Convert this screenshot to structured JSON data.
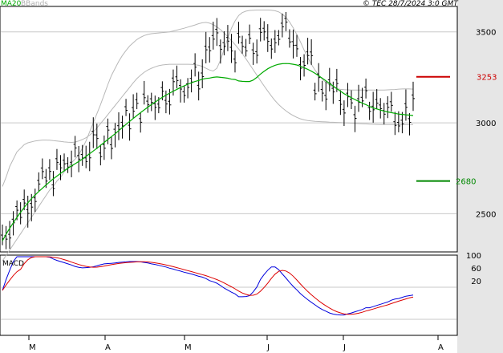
{
  "header": {
    "ma_label": "MA20",
    "bb_label": "BBands",
    "copyright": "© TEC 28/7/2024 3:0 GMT"
  },
  "colors": {
    "ma": "#00aa00",
    "bbands": "#b8b8b8",
    "resistance": "#cc0000",
    "support": "#008800",
    "macd": "#0000dd",
    "signal": "#dd0000",
    "candles": "#000000",
    "grid": "#c8c8c8",
    "panel_bg": "#ffffff",
    "side_bg": "#e8e8e8"
  },
  "chart_data": [
    {
      "type": "line",
      "subtype": "ohlc-bars",
      "title": "",
      "ylim": [
        2290,
        3640
      ],
      "y_ticks": [
        3500,
        3000,
        2500
      ],
      "x_ticks": [
        "M",
        "A",
        "M",
        "J",
        "J",
        "A"
      ],
      "levels": [
        {
          "label": "3253",
          "value": 3253,
          "role": "resistance"
        },
        {
          "label": "2680",
          "value": 2680,
          "role": "support"
        }
      ],
      "series": [
        {
          "name": "MA20",
          "values": [
            2350,
            2387,
            2420,
            2450,
            2480,
            2508,
            2535,
            2560,
            2583,
            2603,
            2622,
            2640,
            2658,
            2675,
            2692,
            2707,
            2722,
            2736,
            2750,
            2763,
            2775,
            2787,
            2800,
            2815,
            2830,
            2845,
            2860,
            2876,
            2892,
            2908,
            2924,
            2940,
            2957,
            2974,
            2991,
            3008,
            3024,
            3040,
            3056,
            3071,
            3086,
            3100,
            3114,
            3127,
            3140,
            3152,
            3163,
            3174,
            3184,
            3194,
            3203,
            3212,
            3220,
            3227,
            3233,
            3240,
            3244,
            3246,
            3250,
            3252,
            3250,
            3248,
            3245,
            3240,
            3238,
            3230,
            3228,
            3227,
            3227,
            3235,
            3250,
            3268,
            3283,
            3297,
            3308,
            3316,
            3322,
            3325,
            3326,
            3325,
            3322,
            3318,
            3311,
            3303,
            3294,
            3284,
            3272,
            3259,
            3245,
            3231,
            3216,
            3202,
            3188,
            3174,
            3160,
            3150,
            3138,
            3128,
            3118,
            3108,
            3100,
            3090,
            3082,
            3076,
            3070,
            3064,
            3060,
            3056,
            3052,
            3048,
            3046,
            3044,
            3042,
            3040
          ]
        },
        {
          "name": "BB-upper",
          "values": [
            2650,
            2700,
            2760,
            2800,
            2840,
            2860,
            2880,
            2890,
            2895,
            2900,
            2903,
            2905,
            2905,
            2904,
            2902,
            2900,
            2898,
            2895,
            2893,
            2892,
            2894,
            2900,
            2908,
            2918,
            2932,
            2950,
            2972,
            2996,
            3020,
            3045,
            3070,
            3095,
            3120,
            3145,
            3170,
            3195,
            3220,
            3243,
            3262,
            3278,
            3290,
            3300,
            3308,
            3314,
            3318,
            3320,
            3322,
            3322,
            3322,
            3322,
            3322,
            3322,
            3321,
            3319,
            3316,
            3310,
            3300,
            3290,
            3285,
            3300,
            3345,
            3405,
            3465,
            3520,
            3560,
            3590,
            3606,
            3614,
            3618,
            3619,
            3620,
            3620,
            3620,
            3620,
            3619,
            3616,
            3610,
            3598,
            3580,
            3555,
            3522,
            3485,
            3445,
            3400,
            3360,
            3322,
            3290,
            3262,
            3240,
            3222,
            3208,
            3196,
            3188,
            3184,
            3182,
            3181,
            3180,
            3180,
            3180,
            3180,
            3180,
            3180,
            3180,
            3180,
            3180,
            3180,
            3181,
            3182,
            3183,
            3185,
            3186,
            3187,
            3186,
            3185
          ]
        },
        {
          "name": "BB-lower",
          "values": [
            2240,
            2270,
            2300,
            2330,
            2360,
            2390,
            2420,
            2450,
            2480,
            2510,
            2540,
            2570,
            2600,
            2630,
            2650,
            2680,
            2700,
            2730,
            2750,
            2780,
            2800,
            2825,
            2860,
            2900,
            2950,
            3000,
            3050,
            3100,
            3155,
            3210,
            3260,
            3300,
            3338,
            3370,
            3398,
            3422,
            3440,
            3458,
            3470,
            3480,
            3486,
            3490,
            3492,
            3494,
            3496,
            3498,
            3500,
            3505,
            3510,
            3515,
            3520,
            3526,
            3532,
            3538,
            3545,
            3550,
            3552,
            3548,
            3540,
            3528,
            3512,
            3494,
            3474,
            3452,
            3430,
            3406,
            3380,
            3352,
            3322,
            3292,
            3262,
            3232,
            3203,
            3174,
            3147,
            3122,
            3100,
            3082,
            3066,
            3052,
            3040,
            3030,
            3022,
            3016,
            3012,
            3010,
            3008,
            3007,
            3006,
            3005,
            3004,
            3003,
            3002,
            3001,
            3000,
            2999,
            2998,
            2997,
            2996,
            2995,
            2994,
            2993,
            2992,
            2991,
            2990,
            2990,
            2990,
            2990,
            2990,
            2990,
            2990,
            2990,
            2990,
            2990
          ]
        },
        {
          "name": "OHLC",
          "values": []
        }
      ]
    },
    {
      "type": "line",
      "title": "MACD",
      "ylim": [
        -150,
        100
      ],
      "y_ticks": [
        100,
        60,
        20
      ],
      "x_ticks": [
        "M",
        "A",
        "M",
        "J",
        "J",
        "A"
      ],
      "series": [
        {
          "name": "MACD",
          "values": []
        },
        {
          "name": "Signal",
          "values": []
        }
      ]
    }
  ]
}
